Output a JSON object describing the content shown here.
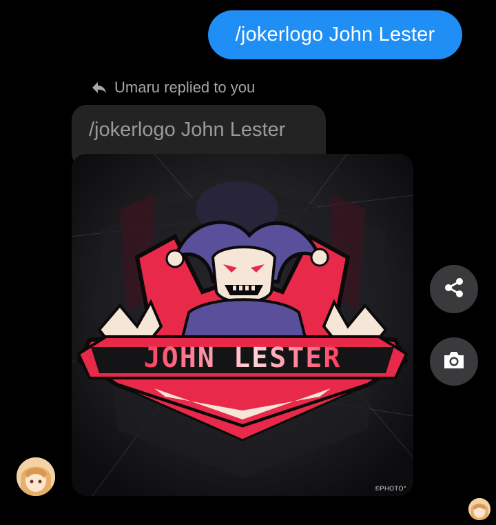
{
  "sent_message": {
    "text": "/jokerlogo John Lester"
  },
  "reply_indicator": {
    "text": "Umaru replied to you",
    "icon": "reply-arrow-icon"
  },
  "quoted_message": {
    "text": "/jokerlogo John Lester"
  },
  "logo_image": {
    "banner_text": "JOHN LESTER",
    "watermark": "©PHOTO°",
    "colors": {
      "red": "#e8294a",
      "purple": "#5a4f9b",
      "cream": "#f5e6d8",
      "dark": "#141416"
    }
  },
  "actions": {
    "share_icon": "share-icon",
    "camera_icon": "camera-icon"
  },
  "avatars": {
    "sender": "avatar-umaru",
    "seen": "seen-avatar-umaru"
  },
  "theme": {
    "sent_bubble": "#1f8ef5",
    "received_bubble": "#232323",
    "action_button": "#3a3a3c"
  }
}
